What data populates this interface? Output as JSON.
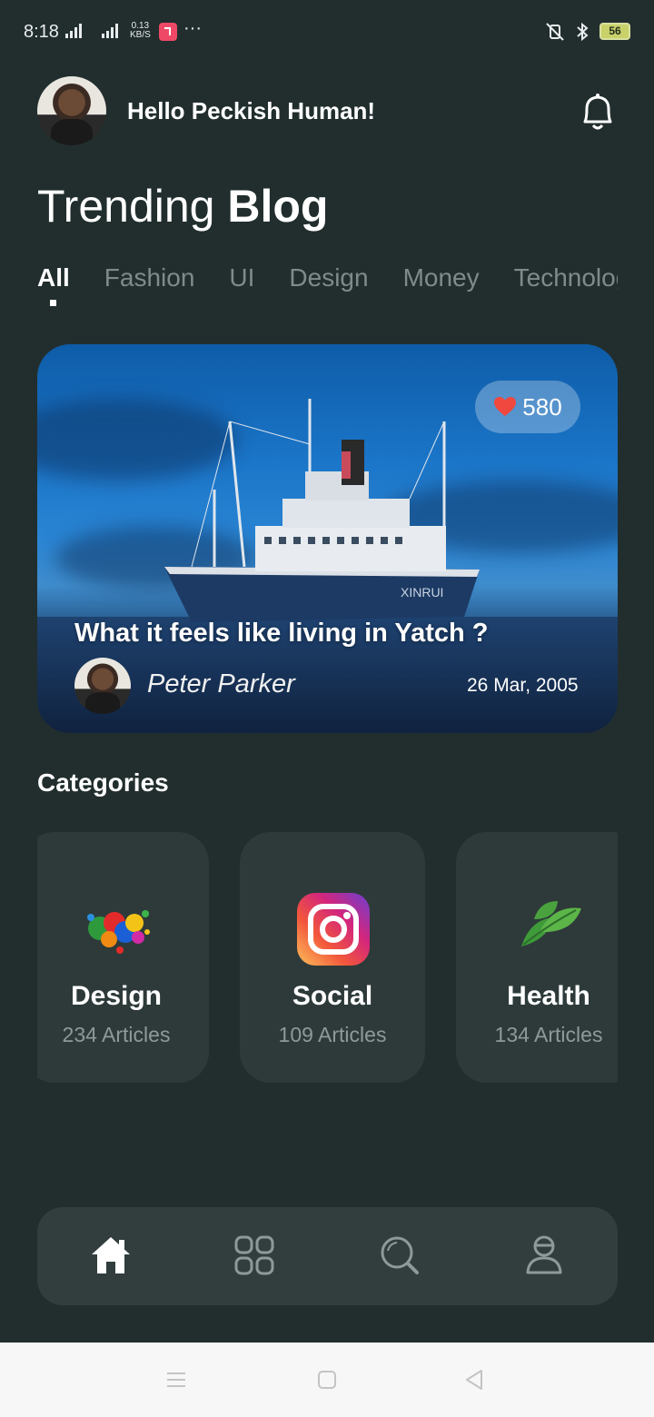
{
  "status_bar": {
    "time": "8:18",
    "net_speed_value": "0.13",
    "net_speed_unit": "KB/S",
    "battery": "56"
  },
  "header": {
    "greeting": "Hello Peckish Human!"
  },
  "page_title": {
    "light": "Trending ",
    "bold": "Blog"
  },
  "tabs": [
    {
      "label": "All",
      "active": true
    },
    {
      "label": "Fashion",
      "active": false
    },
    {
      "label": "UI",
      "active": false
    },
    {
      "label": "Design",
      "active": false
    },
    {
      "label": "Money",
      "active": false
    },
    {
      "label": "Technology",
      "active": false
    }
  ],
  "featured_post": {
    "likes": "580",
    "title": "What it feels like living in Yatch ?",
    "author": "Peter Parker",
    "date": "26 Mar, 2005",
    "ship_name": "XINRUI"
  },
  "categories": {
    "heading": "Categories",
    "items": [
      {
        "name": "Design",
        "count": "234 Articles",
        "icon": "paint-splash-icon"
      },
      {
        "name": "Social",
        "count": "109 Articles",
        "icon": "instagram-icon"
      },
      {
        "name": "Health",
        "count": "134 Articles",
        "icon": "mint-leaf-icon"
      }
    ]
  },
  "bottom_nav": {
    "items": [
      "home-icon",
      "grid-icon",
      "search-icon",
      "profile-icon"
    ],
    "active": "home-icon"
  },
  "colors": {
    "background": "#222e2e",
    "card": "#2e3a3a",
    "nav": "#323e3e",
    "muted_text": "#8e9a9a"
  }
}
